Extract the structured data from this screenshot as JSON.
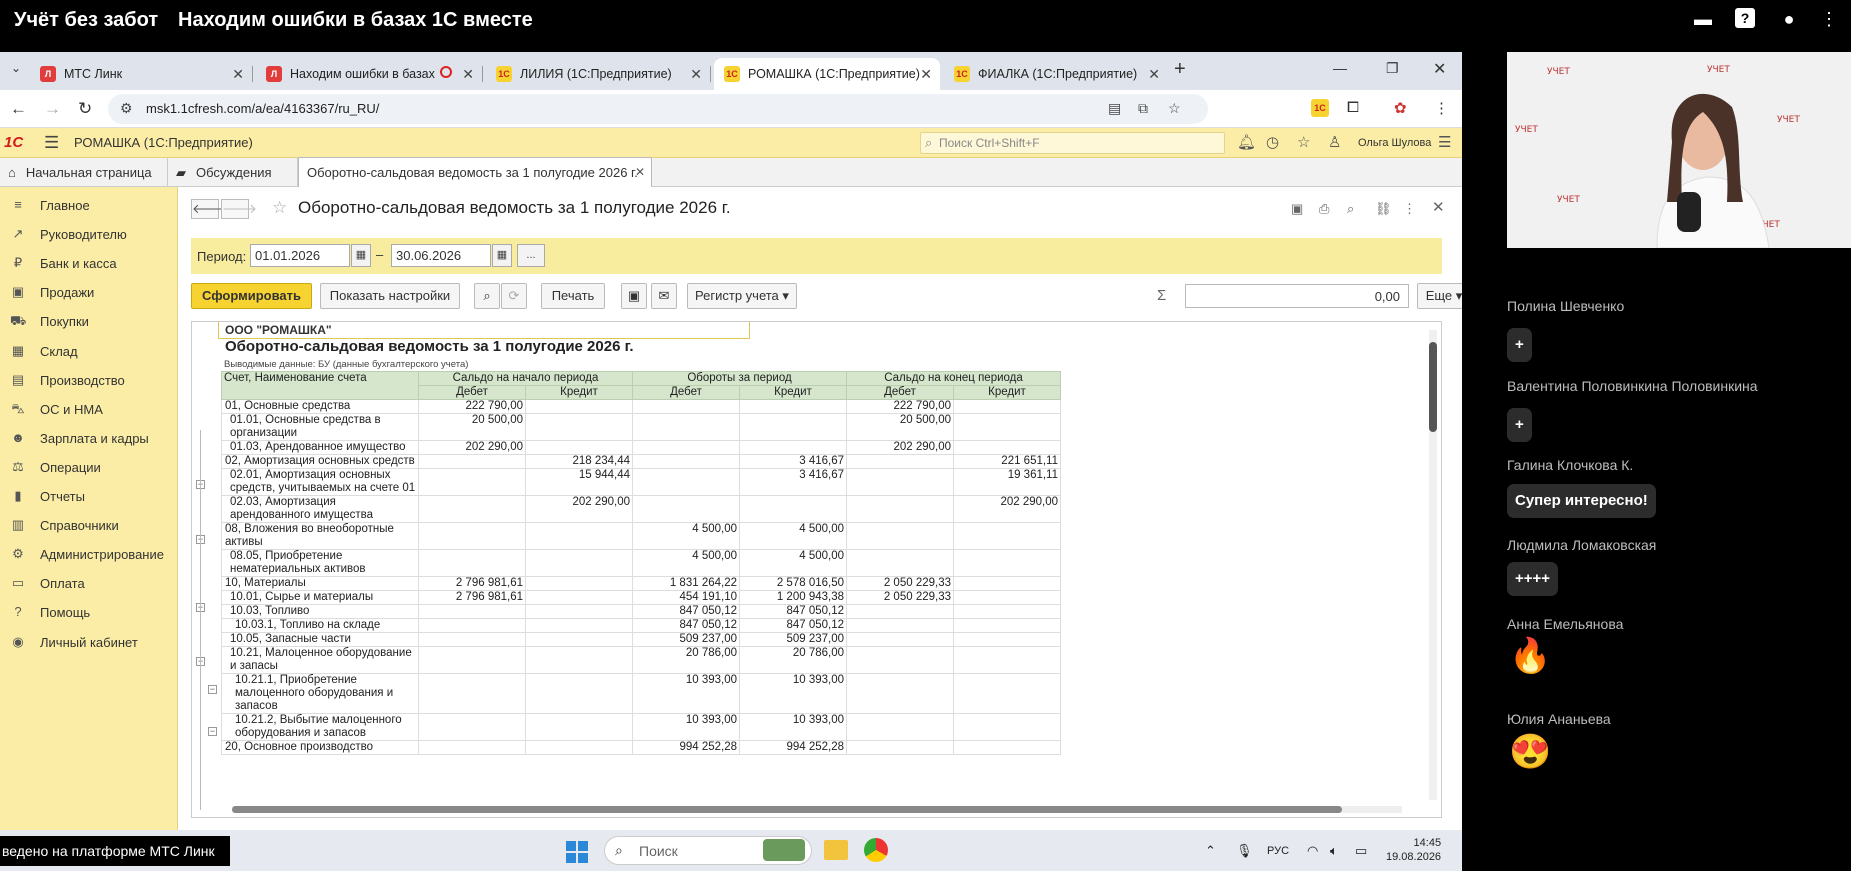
{
  "meeting": {
    "brand": "Учёт без забот",
    "title": "Находим ошибки в базах 1С вместе"
  },
  "browser": {
    "tabs": [
      {
        "label": "МТС Линк",
        "fav_color": "#e23d3d",
        "fav_text": "Л"
      },
      {
        "label": "Находим ошибки в базах",
        "fav_color": "#e23d3d",
        "fav_text": "Л"
      },
      {
        "label": "ЛИЛИЯ (1С:Предприятие)",
        "fav_color": "#f6d330",
        "fav_text": "1С"
      },
      {
        "label": "РОМАШКА (1С:Предприятие)",
        "fav_color": "#f6d330",
        "fav_text": "1С"
      },
      {
        "label": "ФИАЛКА (1С:Предприятие)",
        "fav_color": "#f6d330",
        "fav_text": "1С"
      }
    ],
    "url": "msk1.1cfresh.com/a/ea/4163367/ru_RU/"
  },
  "app": {
    "logo": "1С",
    "name": "РОМАШКА  (1С:Предприятие)",
    "search_placeholder": "Поиск Ctrl+Shift+F",
    "user": "Ольга Шулова",
    "tabs": {
      "home": "Начальная страница",
      "discuss": "Обсуждения",
      "current": "Оборотно-сальдовая ведомость за 1 полугодие 2026 г."
    },
    "sidebar": [
      {
        "label": "Главное",
        "icon": "≡"
      },
      {
        "label": "Руководителю",
        "icon": "↗"
      },
      {
        "label": "Банк и касса",
        "icon": "₽"
      },
      {
        "label": "Продажи",
        "icon": "▣"
      },
      {
        "label": "Покупки",
        "icon": "⛟"
      },
      {
        "label": "Склад",
        "icon": "▦"
      },
      {
        "label": "Производство",
        "icon": "▤"
      },
      {
        "label": "ОС и НМА",
        "icon": "⛍"
      },
      {
        "label": "Зарплата и кадры",
        "icon": "☻"
      },
      {
        "label": "Операции",
        "icon": "⚖"
      },
      {
        "label": "Отчеты",
        "icon": "▮"
      },
      {
        "label": "Справочники",
        "icon": "▥"
      },
      {
        "label": "Администрирование",
        "icon": "⚙"
      },
      {
        "label": "Оплата",
        "icon": "▭"
      },
      {
        "label": "Помощь",
        "icon": "?"
      },
      {
        "label": "Личный кабинет",
        "icon": "◉"
      }
    ],
    "form": {
      "title": "Оборотно-сальдовая ведомость за 1 полугодие 2026 г.",
      "period_label": "Период:",
      "date_from": "01.01.2026",
      "date_to": "30.06.2026",
      "more": "...",
      "btn_generate": "Сформировать",
      "btn_settings": "Показать настройки",
      "btn_print": "Печать",
      "btn_register": "Регистр учета",
      "btn_more": "Еще",
      "sum_value": "0,00"
    },
    "report": {
      "org": "ООО \"РОМАШКА\"",
      "title": "Оборотно-сальдовая ведомость за 1 полугодие 2026 г.",
      "subtitle": "Выводимые данные:  БУ (данные бухгалтерского учета)",
      "h_account": "Счет, Наименование счета",
      "h_open": "Сальдо на начало периода",
      "h_turn": "Обороты за период",
      "h_close": "Сальдо на конец периода",
      "h_debit": "Дебет",
      "h_credit": "Кредит",
      "rows": [
        {
          "name": "01, Основные средства",
          "ind": 0,
          "v": [
            "222 790,00",
            "",
            "",
            "",
            "222 790,00",
            ""
          ]
        },
        {
          "name": "01.01, Основные средства в организации",
          "ind": 1,
          "v": [
            "20 500,00",
            "",
            "",
            "",
            "20 500,00",
            ""
          ]
        },
        {
          "name": "01.03, Арендованное имущество",
          "ind": 1,
          "v": [
            "202 290,00",
            "",
            "",
            "",
            "202 290,00",
            ""
          ]
        },
        {
          "name": "02, Амортизация основных средств",
          "ind": 0,
          "v": [
            "",
            "218 234,44",
            "",
            "3 416,67",
            "",
            "221 651,11"
          ]
        },
        {
          "name": "02.01, Амортизация основных средств, учитываемых на счете 01",
          "ind": 1,
          "v": [
            "",
            "15 944,44",
            "",
            "3 416,67",
            "",
            "19 361,11"
          ]
        },
        {
          "name": "02.03, Амортизация арендованного имущества",
          "ind": 1,
          "v": [
            "",
            "202 290,00",
            "",
            "",
            "",
            "202 290,00"
          ]
        },
        {
          "name": "08, Вложения во внеоборотные активы",
          "ind": 0,
          "v": [
            "",
            "",
            "4 500,00",
            "4 500,00",
            "",
            ""
          ]
        },
        {
          "name": "08.05, Приобретение нематериальных активов",
          "ind": 1,
          "v": [
            "",
            "",
            "4 500,00",
            "4 500,00",
            "",
            ""
          ]
        },
        {
          "name": "10, Материалы",
          "ind": 0,
          "v": [
            "2 796 981,61",
            "",
            "1 831 264,22",
            "2 578 016,50",
            "2 050 229,33",
            ""
          ]
        },
        {
          "name": "10.01, Сырье и материалы",
          "ind": 1,
          "v": [
            "2 796 981,61",
            "",
            "454 191,10",
            "1 200 943,38",
            "2 050 229,33",
            ""
          ]
        },
        {
          "name": "10.03, Топливо",
          "ind": 1,
          "v": [
            "",
            "",
            "847 050,12",
            "847 050,12",
            "",
            ""
          ]
        },
        {
          "name": "10.03.1, Топливо на складе",
          "ind": 2,
          "v": [
            "",
            "",
            "847 050,12",
            "847 050,12",
            "",
            ""
          ]
        },
        {
          "name": "10.05, Запасные части",
          "ind": 1,
          "v": [
            "",
            "",
            "509 237,00",
            "509 237,00",
            "",
            ""
          ]
        },
        {
          "name": "10.21, Малоценное оборудование и запасы",
          "ind": 1,
          "v": [
            "",
            "",
            "20 786,00",
            "20 786,00",
            "",
            ""
          ]
        },
        {
          "name": "10.21.1, Приобретение малоценного оборудования и запасов",
          "ind": 2,
          "v": [
            "",
            "",
            "10 393,00",
            "10 393,00",
            "",
            ""
          ]
        },
        {
          "name": "10.21.2, Выбытие малоценного оборудования и запасов",
          "ind": 2,
          "v": [
            "",
            "",
            "10 393,00",
            "10 393,00",
            "",
            ""
          ]
        },
        {
          "name": "20, Основное производство",
          "ind": 0,
          "v": [
            "",
            "",
            "994 252,28",
            "994 252,28",
            "",
            ""
          ]
        }
      ]
    }
  },
  "chat": [
    {
      "name": "Полина Шевченко",
      "msg": "+",
      "kind": "chip"
    },
    {
      "name": "Валентина Половинкина Половинкина",
      "msg": "+",
      "kind": "chip"
    },
    {
      "name": "Галина Клочкова К.",
      "msg": "Супер интересно!",
      "kind": "chip"
    },
    {
      "name": "Людмила Ломаковская",
      "msg": "++++",
      "kind": "chip"
    },
    {
      "name": "Анна Емельянова",
      "msg": "🔥",
      "kind": "emoji"
    },
    {
      "name": "Юлия Ананьева",
      "msg": "😍",
      "kind": "emoji"
    }
  ],
  "camera_wall_text": "УЧЕТ",
  "platform_label": "ведено на платформе МТС Линк",
  "taskbar": {
    "search": "Поиск",
    "lang": "РУС",
    "time": "14:45",
    "date": "19.08.2026"
  }
}
